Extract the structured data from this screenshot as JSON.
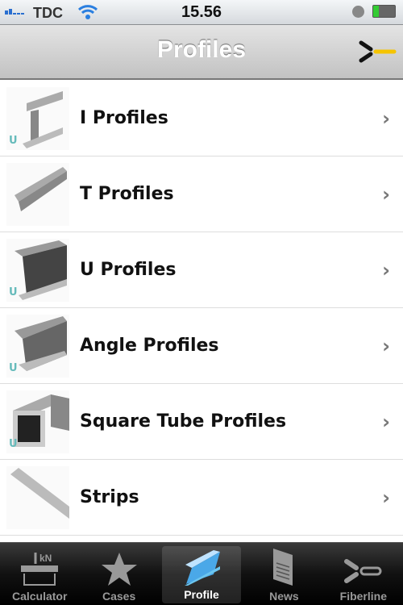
{
  "status": {
    "carrier": "TDC",
    "time": "15.56"
  },
  "nav": {
    "title": "Profiles",
    "logo_icon": "fiberline-logo"
  },
  "list": [
    {
      "label": "I Profiles",
      "badge": "U"
    },
    {
      "label": "T Profiles",
      "badge": ""
    },
    {
      "label": "U Profiles",
      "badge": "U"
    },
    {
      "label": "Angle Profiles",
      "badge": "U"
    },
    {
      "label": "Square Tube Profiles",
      "badge": "U"
    },
    {
      "label": "Strips",
      "badge": ""
    }
  ],
  "tabs": [
    {
      "label": "Calculator",
      "icon": "beam-load-icon"
    },
    {
      "label": "Cases",
      "icon": "star-icon"
    },
    {
      "label": "Profile",
      "icon": "profile-icon",
      "active": true
    },
    {
      "label": "News",
      "icon": "news-icon"
    },
    {
      "label": "Fiberline",
      "icon": "fiberline-icon"
    }
  ],
  "colors": {
    "accent": "#f5c400",
    "active_tab_icon": "#4aa8e8"
  },
  "chevron": "›"
}
